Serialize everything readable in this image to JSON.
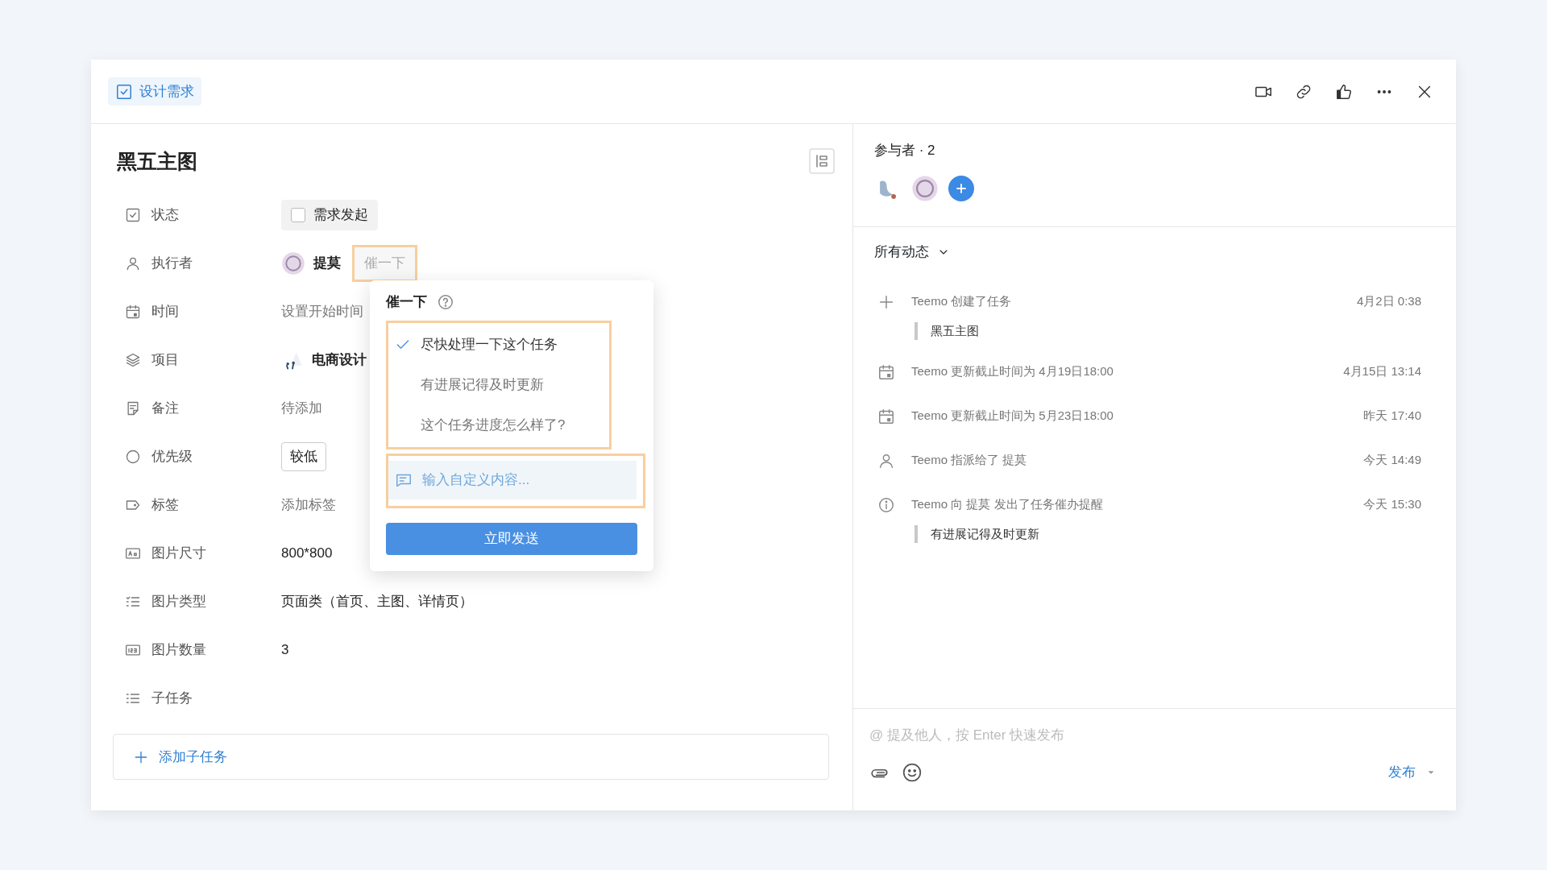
{
  "header": {
    "tag": "设计需求"
  },
  "task": {
    "title": "黑五主图",
    "fields": [
      {
        "label": "状态",
        "kind": "checkbox",
        "value": "需求发起",
        "checked": false
      },
      {
        "label": "执行者",
        "kind": "person",
        "value": "提莫",
        "action": "催一下"
      },
      {
        "label": "时间",
        "kind": "placeholder",
        "placeholder": "设置开始时间"
      },
      {
        "label": "项目",
        "kind": "project",
        "value": "电商设计"
      },
      {
        "label": "备注",
        "kind": "placeholder",
        "placeholder": "待添加"
      },
      {
        "label": "优先级",
        "kind": "tag",
        "value": "较低"
      },
      {
        "label": "标签",
        "kind": "placeholder",
        "placeholder": "添加标签"
      },
      {
        "label": "图片尺寸",
        "kind": "text",
        "value": "800*800"
      },
      {
        "label": "图片类型",
        "kind": "text",
        "value": "页面类（首页、主图、详情页）"
      },
      {
        "label": "图片数量",
        "kind": "text",
        "value": "3"
      },
      {
        "label": "子任务",
        "kind": "section"
      }
    ],
    "add_subtask": "添加子任务"
  },
  "nudge_popover": {
    "title": "催一下",
    "options": [
      {
        "text": "尽快处理一下这个任务",
        "selected": true
      },
      {
        "text": "有进展记得及时更新",
        "selected": false
      },
      {
        "text": "这个任务进度怎么样了?",
        "selected": false
      }
    ],
    "custom_placeholder": "输入自定义内容...",
    "send": "立即发送"
  },
  "participants": {
    "title": "参与者 · 2"
  },
  "activity": {
    "filter": "所有动态",
    "items": [
      {
        "kind": "create",
        "text": "Teemo 创建了任务",
        "time": "4月2日 0:38",
        "quote": "黑五主图"
      },
      {
        "kind": "date",
        "text": "Teemo 更新截止时间为 4月19日18:00",
        "time": "4月15日 13:14"
      },
      {
        "kind": "date",
        "text": "Teemo 更新截止时间为 5月23日18:00",
        "time": "昨天 17:40"
      },
      {
        "kind": "assign",
        "text": "Teemo 指派给了 提莫",
        "time": "今天 14:49"
      },
      {
        "kind": "remind",
        "text": "Teemo 向 提莫 发出了任务催办提醒",
        "time": "今天 15:30",
        "quote": "有进展记得及时更新"
      }
    ]
  },
  "comment": {
    "placeholder": "@ 提及他人，按 Enter 快速发布",
    "submit": "发布"
  }
}
